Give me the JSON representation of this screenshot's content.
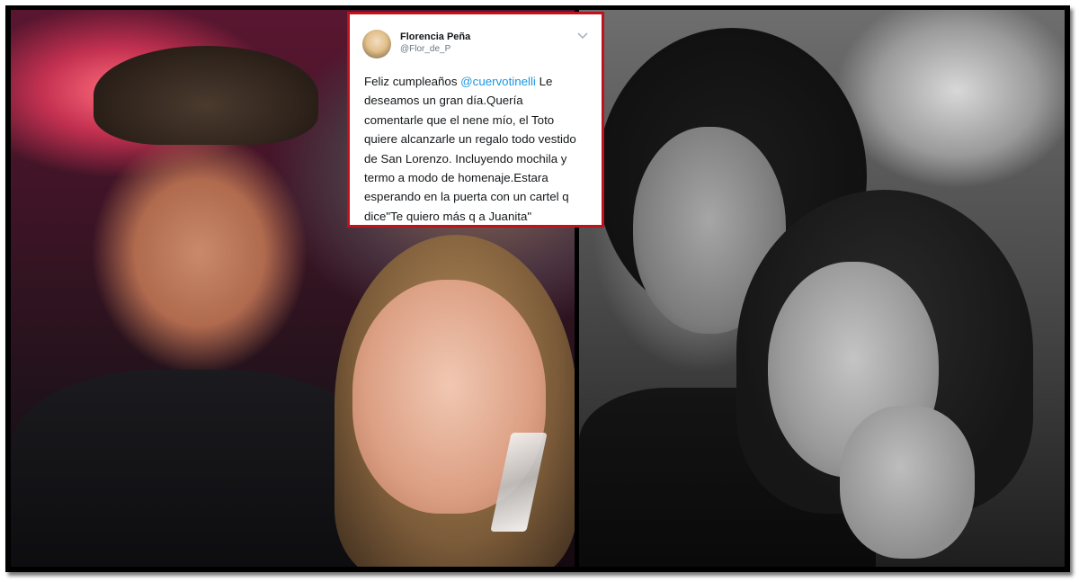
{
  "tweet": {
    "author_name": "Florencia Peña",
    "author_handle": "@Flor_de_P",
    "menu_icon": "chevron-down-icon",
    "lines": [
      {
        "pre": "Feliz cumpleaños ",
        "mention": "@cuervotinelli",
        "post": " Le"
      },
      {
        "text": "deseamos un gran día.Quería"
      },
      {
        "text": "comentarle que el nene mío, el Toto"
      },
      {
        "text": "quiere alcanzarle un regalo todo vestido"
      },
      {
        "text": "de San Lorenzo. Incluyendo mochila y"
      },
      {
        "text": "termo a modo de homenaje.Estara"
      },
      {
        "text": "esperando en la puerta con un cartel q"
      },
      {
        "text": "dice\"Te quiero más q a Juanita\""
      }
    ],
    "border_color": "#c0121a",
    "mention_color": "#1b95e0"
  }
}
